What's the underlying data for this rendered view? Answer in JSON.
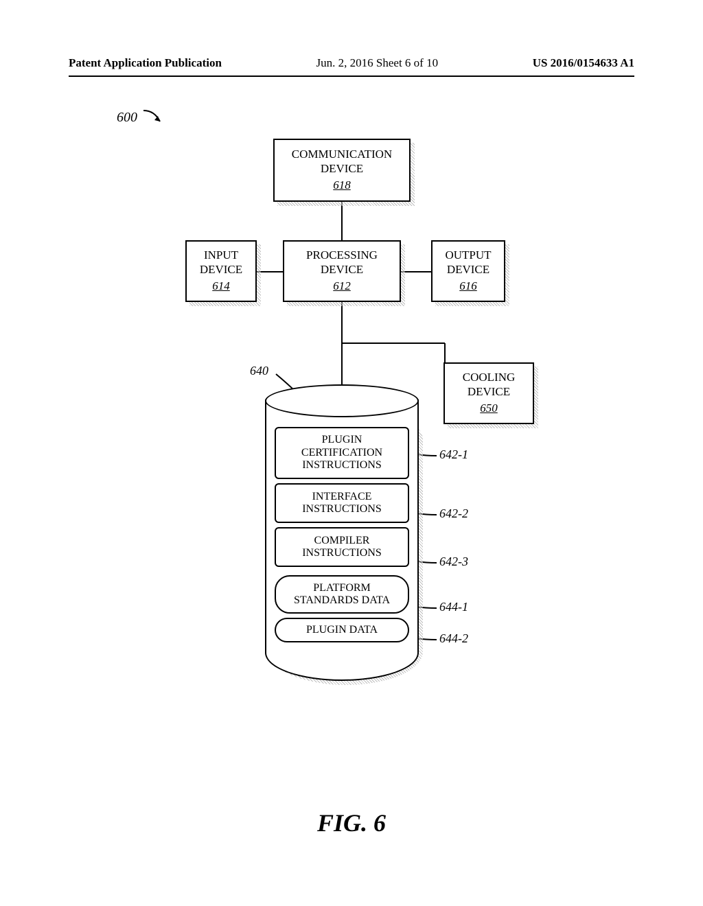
{
  "header": {
    "left": "Patent Application Publication",
    "mid": "Jun. 2, 2016   Sheet 6 of 10",
    "right": "US 2016/0154633 A1"
  },
  "overall_ref": "600",
  "boxes": {
    "comm": {
      "title1": "COMMUNICATION",
      "title2": "DEVICE",
      "ref": "618"
    },
    "input": {
      "title1": "INPUT",
      "title2": "DEVICE",
      "ref": "614"
    },
    "proc": {
      "title1": "PROCESSING",
      "title2": "DEVICE",
      "ref": "612"
    },
    "output": {
      "title1": "OUTPUT",
      "title2": "DEVICE",
      "ref": "616"
    },
    "cool": {
      "title1": "COOLING",
      "title2": "DEVICE",
      "ref": "650"
    }
  },
  "cyl": {
    "ref": "640",
    "items": [
      {
        "t1": "PLUGIN",
        "t2": "CERTIFICATION",
        "t3": "INSTRUCTIONS",
        "ref": "642-1"
      },
      {
        "t1": "INTERFACE",
        "t2": "INSTRUCTIONS",
        "ref": "642-2"
      },
      {
        "t1": "COMPILER",
        "t2": "INSTRUCTIONS",
        "ref": "642-3"
      },
      {
        "t1": "PLATFORM",
        "t2": "STANDARDS DATA",
        "ref": "644-1"
      },
      {
        "t1": "PLUGIN DATA",
        "ref": "644-2"
      }
    ]
  },
  "figure": "FIG. 6"
}
